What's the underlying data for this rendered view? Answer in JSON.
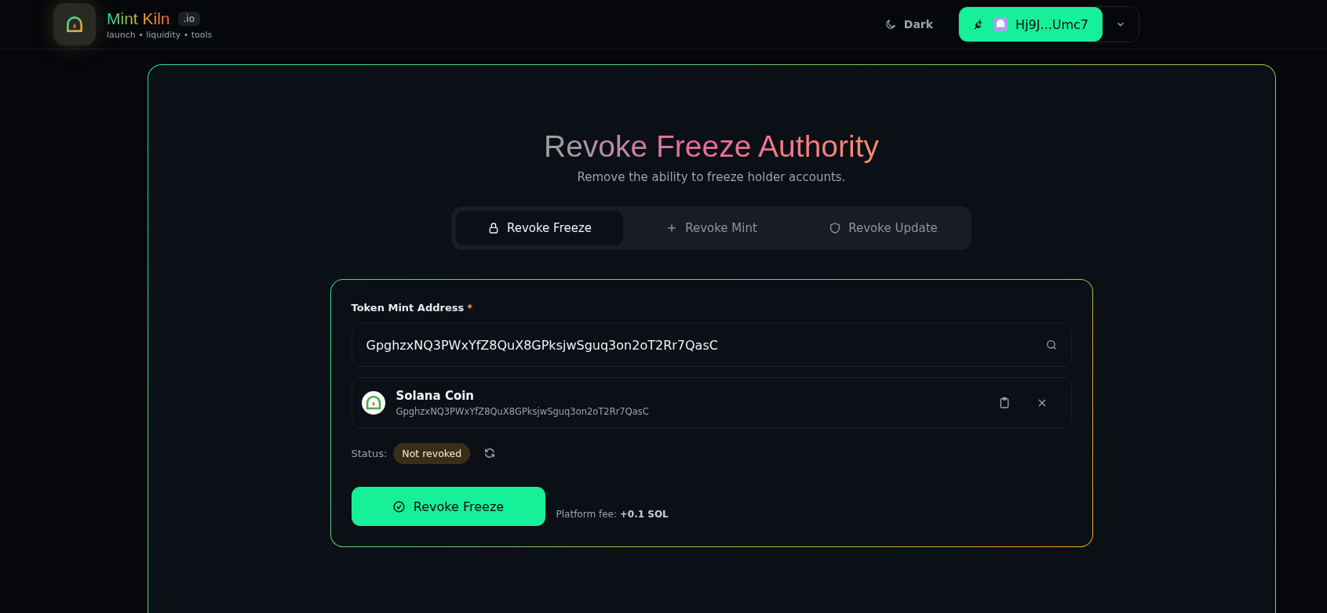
{
  "brand": {
    "name": "Mint Kiln",
    "badge": ".io",
    "tagline": "launch • liquidity • tools"
  },
  "header": {
    "theme_toggle": "Dark",
    "wallet": "Hj9J...Umc7"
  },
  "page": {
    "title": "Revoke Freeze Authority",
    "subtitle": "Remove the ability to freeze holder accounts."
  },
  "tabs": [
    {
      "label": "Revoke Freeze",
      "selected": true
    },
    {
      "label": "Revoke Mint",
      "selected": false
    },
    {
      "label": "Revoke Update",
      "selected": false
    }
  ],
  "form": {
    "label": "Token Mint Address",
    "required_mark": "*",
    "value": "GpghzxNQ3PWxYfZ8QuX8GPksjwSguq3on2oT2Rr7QasC",
    "token": {
      "name": "Solana Coin",
      "address": "GpghzxNQ3PWxYfZ8QuX8GPksjwSguq3on2oT2Rr7QasC"
    },
    "status_label": "Status:",
    "status": "Not revoked",
    "submit": "Revoke Freeze",
    "fee": "Platform fee: **+0.1 SOL**"
  }
}
